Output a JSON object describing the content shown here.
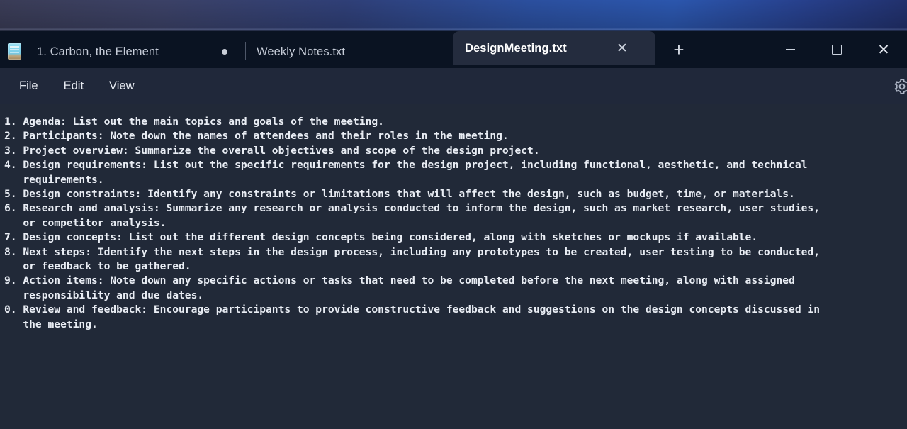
{
  "window": {
    "title": "DesignMeeting.txt",
    "caption_buttons": [
      {
        "name": "minimize",
        "label": "—"
      },
      {
        "name": "maximize",
        "label": "□"
      },
      {
        "name": "close",
        "label": "✕"
      }
    ]
  },
  "tabstrip": {
    "app_icon": "notepad-icon",
    "tabs": [
      {
        "label": "1. Carbon, the Element",
        "active": false,
        "modified": true
      },
      {
        "label": "Weekly Notes.txt",
        "active": false,
        "modified": false
      },
      {
        "label": "DesignMeeting.txt",
        "active": true,
        "modified": false,
        "close_label": "✕"
      }
    ],
    "new_tab_label": "+"
  },
  "menubar": {
    "items": [
      {
        "label": "File"
      },
      {
        "label": "Edit"
      },
      {
        "label": "View"
      }
    ],
    "settings_icon": "gear-icon"
  },
  "editor": {
    "content": "1. Agenda: List out the main topics and goals of the meeting.\n2. Participants: Note down the names of attendees and their roles in the meeting.\n3. Project overview: Summarize the overall objectives and scope of the design project.\n4. Design requirements: List out the specific requirements for the design project, including functional, aesthetic, and technical\n   requirements.\n5. Design constraints: Identify any constraints or limitations that will affect the design, such as budget, time, or materials.\n6. Research and analysis: Summarize any research or analysis conducted to inform the design, such as market research, user studies,\n   or competitor analysis.\n7. Design concepts: List out the different design concepts being considered, along with sketches or mockups if available.\n8. Next steps: Identify the next steps in the design process, including any prototypes to be created, user testing to be conducted,\n   or feedback to be gathered.\n9. Action items: Note down any specific actions or tasks that need to be completed before the next meeting, along with assigned\n   responsibility and due dates.\n0. Review and feedback: Encourage participants to provide constructive feedback and suggestions on the design concepts discussed in\n   the meeting."
  },
  "colors": {
    "tabstrip_bg": "#0a1322",
    "window_bg": "#20283a",
    "editor_bg": "#212938",
    "active_tab_bg": "#242c3e",
    "text": "#e9edf4",
    "desktop_accent": "#2b56ad"
  }
}
